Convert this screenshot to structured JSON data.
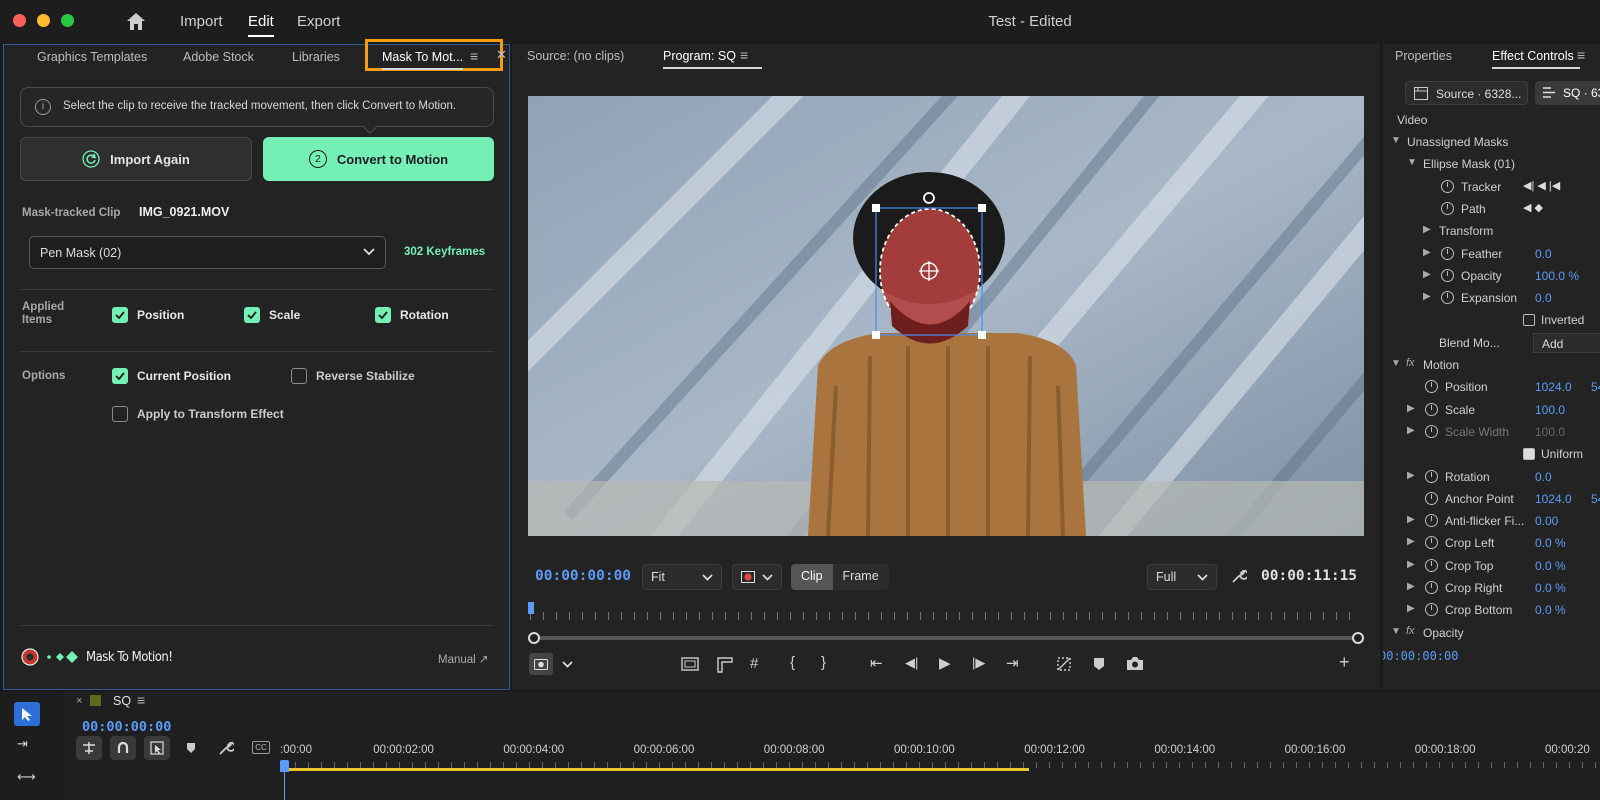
{
  "window": {
    "title": "Test - Edited",
    "menu": [
      "Import",
      "Edit",
      "Export"
    ],
    "active_menu": "Edit",
    "colors": {
      "close": "#ff5f57",
      "minimize": "#febc2e",
      "zoom": "#28c840"
    }
  },
  "left_panel": {
    "tabs": [
      "Graphics Templates",
      "Adobe Stock",
      "Libraries",
      "Mask To Mot..."
    ],
    "active_tab": "Mask To Mot...",
    "highlight_color": "#f39c12",
    "info_text": "Select the clip to receive the tracked movement, then click Convert to Motion.",
    "import_again_label": "Import Again",
    "convert_step": "2",
    "convert_label": "Convert to Motion",
    "accent_color": "#74f0b6",
    "mask_tracked_label": "Mask-tracked Clip",
    "mask_tracked_value": "IMG_0921.MOV",
    "mask_select": "Pen Mask (02)",
    "keyframes": "302 Keyframes",
    "applied_items_label": "Applied Items",
    "applied_items": [
      {
        "label": "Position",
        "checked": true
      },
      {
        "label": "Scale",
        "checked": true
      },
      {
        "label": "Rotation",
        "checked": true
      }
    ],
    "options_label": "Options",
    "options": [
      {
        "label": "Current Position",
        "checked": true
      },
      {
        "label": "Reverse Stabilize",
        "checked": false
      },
      {
        "label": "Apply to Transform Effect",
        "checked": false
      }
    ],
    "brand": "Mask To Motion!",
    "manual_link": "Manual ↗"
  },
  "monitor": {
    "source_tab": "Source: (no clips)",
    "program_tab": "Program: SQ",
    "timecode_current": "00:00:00:00",
    "fit_select": "Fit",
    "clip_label": "Clip",
    "frame_label": "Frame",
    "quality_select": "Full",
    "timecode_duration": "00:00:11:15"
  },
  "effects": {
    "tabs": [
      "Properties",
      "Effect Controls"
    ],
    "active_tab": "Effect Controls",
    "source_chip": "Source · 6328...",
    "sequence_chip": "SQ · 63",
    "section_video": "Video",
    "rows": [
      {
        "name": "Unassigned Masks",
        "indent": 0,
        "arrow": "down",
        "stopwatch": false,
        "value": ""
      },
      {
        "name": "Ellipse Mask (01)",
        "indent": 1,
        "arrow": "down",
        "stopwatch": false,
        "value": ""
      },
      {
        "name": "Tracker",
        "indent": 2,
        "arrow": "",
        "stopwatch": true,
        "value": ""
      },
      {
        "name": "Path",
        "indent": 2,
        "arrow": "",
        "stopwatch": true,
        "value": ""
      },
      {
        "name": "Transform",
        "indent": 2,
        "arrow": "right",
        "stopwatch": false,
        "value": ""
      },
      {
        "name": "Feather",
        "indent": 2,
        "arrow": "right",
        "stopwatch": true,
        "value": "0.0"
      },
      {
        "name": "Opacity",
        "indent": 2,
        "arrow": "right",
        "stopwatch": true,
        "value": "100.0 %"
      },
      {
        "name": "Expansion",
        "indent": 2,
        "arrow": "right",
        "stopwatch": true,
        "value": "0.0"
      },
      {
        "name": "Inverted",
        "indent": 3,
        "arrow": "",
        "stopwatch": false,
        "value": ""
      },
      {
        "name": "Blend Mo...",
        "indent": 2,
        "arrow": "",
        "stopwatch": false,
        "value": "Add"
      },
      {
        "name": "Motion",
        "indent": 0,
        "arrow": "down",
        "stopwatch": false,
        "value": ""
      },
      {
        "name": "Position",
        "indent": 1,
        "arrow": "",
        "stopwatch": true,
        "value": "1024.0"
      },
      {
        "name": "Scale",
        "indent": 1,
        "arrow": "right",
        "stopwatch": true,
        "value": "100.0"
      },
      {
        "name": "Scale Width",
        "indent": 1,
        "arrow": "right",
        "stopwatch": true,
        "value": "100.0"
      },
      {
        "name": "Uniform",
        "indent": 3,
        "arrow": "",
        "stopwatch": false,
        "value": ""
      },
      {
        "name": "Rotation",
        "indent": 1,
        "arrow": "right",
        "stopwatch": true,
        "value": "0.0"
      },
      {
        "name": "Anchor Point",
        "indent": 1,
        "arrow": "",
        "stopwatch": true,
        "value": "1024.0"
      },
      {
        "name": "Anti-flicker Fi...",
        "indent": 1,
        "arrow": "right",
        "stopwatch": true,
        "value": "0.00"
      },
      {
        "name": "Crop Left",
        "indent": 1,
        "arrow": "right",
        "stopwatch": true,
        "value": "0.0 %"
      },
      {
        "name": "Crop Top",
        "indent": 1,
        "arrow": "right",
        "stopwatch": true,
        "value": "0.0 %"
      },
      {
        "name": "Crop Right",
        "indent": 1,
        "arrow": "right",
        "stopwatch": true,
        "value": "0.0 %"
      },
      {
        "name": "Crop Bottom",
        "indent": 1,
        "arrow": "right",
        "stopwatch": true,
        "value": "0.0 %"
      },
      {
        "name": "Opacity",
        "indent": 0,
        "arrow": "down",
        "stopwatch": false,
        "value": ""
      }
    ],
    "position_y_partial": "54",
    "anchor_y_partial": "54",
    "timecode": "00:00:00:00"
  },
  "timeline": {
    "sequence_name": "SQ",
    "timecode": "00:00:00:00",
    "ruler": [
      ":00:00",
      "00:00:02:00",
      "00:00:04:00",
      "00:00:06:00",
      "00:00:08:00",
      "00:00:10:00",
      "00:00:12:00",
      "00:00:14:00",
      "00:00:16:00",
      "00:00:18:00",
      "00:00:20"
    ]
  }
}
